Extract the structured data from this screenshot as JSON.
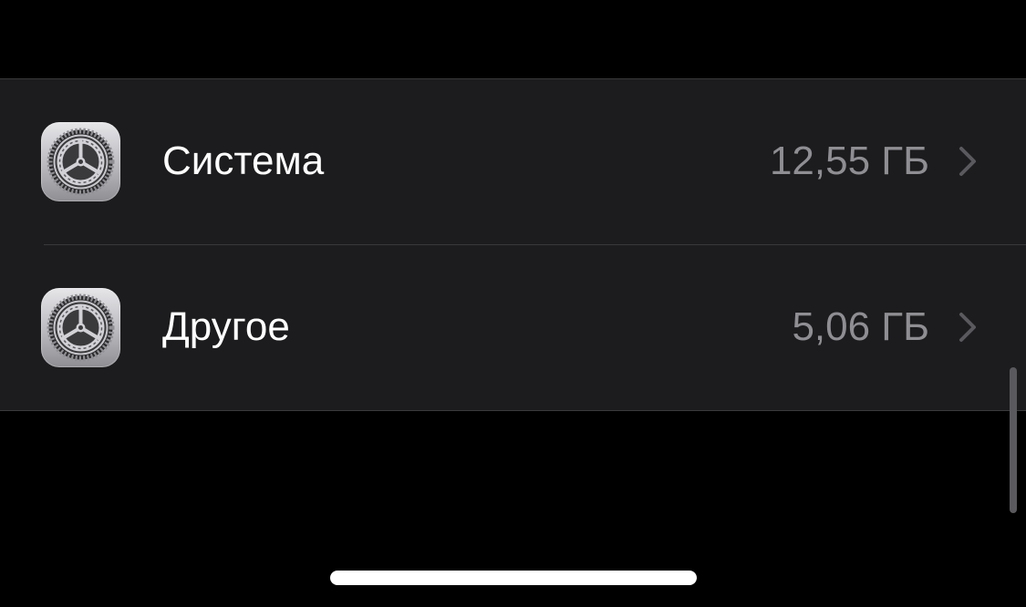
{
  "storage_list": {
    "items": [
      {
        "label": "Система",
        "size": "12,55 ГБ",
        "icon": "settings-gear-icon"
      },
      {
        "label": "Другое",
        "size": "5,06 ГБ",
        "icon": "settings-gear-icon"
      }
    ]
  },
  "colors": {
    "background": "#000000",
    "row_background": "#1c1c1e",
    "label_text": "#ffffff",
    "value_text": "#8e8e93",
    "chevron": "#5a5a5e"
  }
}
